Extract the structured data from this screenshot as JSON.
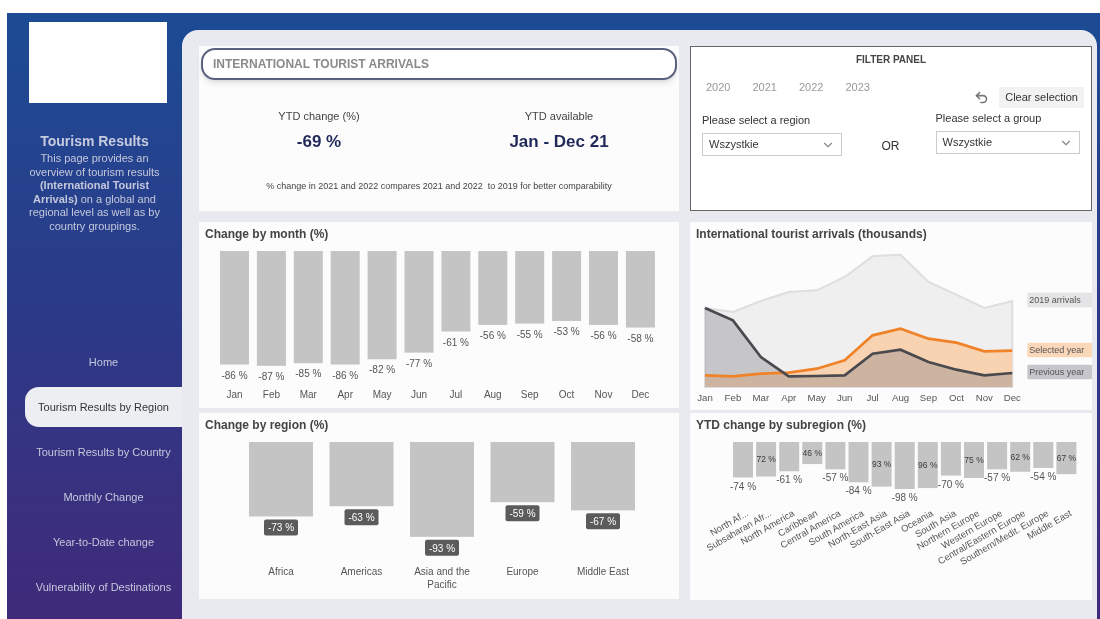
{
  "sidebar": {
    "title": "Tourism Results",
    "description": "This page provides an overview of tourism results **(International Tourist Arrivals)** on a global and regional level as well as by country groupings.",
    "nav": [
      {
        "label": "Home",
        "selected": false
      },
      {
        "label": "Tourism Results by Region",
        "selected": true
      },
      {
        "label": "Tourism Results by Country",
        "selected": false
      },
      {
        "label": "Monthly Change",
        "selected": false
      },
      {
        "label": "Year-to-Date change",
        "selected": false
      },
      {
        "label": "Vulnerability of Destinations",
        "selected": false
      }
    ]
  },
  "kpi_card": {
    "title": "INTERNATIONAL TOURIST ARRIVALS",
    "kpis": [
      {
        "label": "YTD change (%)",
        "value": "-69 %"
      },
      {
        "label": "YTD available",
        "value": "Jan - Dec 21"
      }
    ],
    "note": "% change in 2021 and 2022 compares 2021 and 2022  to 2019 for better comparability"
  },
  "filter_panel": {
    "title": "FILTER PANEL",
    "years": [
      "2020",
      "2021",
      "2022",
      "2023"
    ],
    "clear_button": "Clear selection",
    "region": {
      "label": "Please select a region",
      "value": "Wszystkie"
    },
    "separator": "OR",
    "group": {
      "label": "Please select a group",
      "value": "Wszystkie"
    }
  },
  "month_chart": {
    "title": "Change by month (%)",
    "chart_data": {
      "type": "bar",
      "categories": [
        "Jan",
        "Feb",
        "Mar",
        "Apr",
        "May",
        "Jun",
        "Jul",
        "Aug",
        "Sep",
        "Oct",
        "Nov",
        "Dec"
      ],
      "values": [
        -86,
        -87,
        -85,
        -86,
        -82,
        -77,
        -61,
        -56,
        -55,
        -53,
        -56,
        -58
      ],
      "value_labels": [
        "-86 %",
        "-87 %",
        "-85 %",
        "-86 %",
        "-82 %",
        "-77 %",
        "-61 %",
        "-56 %",
        "-55 %",
        "-53 %",
        "-56 %",
        "-58 %"
      ]
    }
  },
  "arrivals_chart": {
    "title": "International tourist arrivals (thousands)",
    "months": [
      "Jan",
      "Feb",
      "Mar",
      "Apr",
      "May",
      "Jun",
      "Jul",
      "Aug",
      "Sep",
      "Oct",
      "Nov",
      "Dec"
    ],
    "legend": [
      {
        "label": "2019 arrivals",
        "color": "#e4e4e6"
      },
      {
        "label": "Selected year",
        "color": "#f9d7b8"
      },
      {
        "label": "Previous year",
        "color": "#c6c6cc"
      }
    ]
  },
  "region_chart": {
    "title": "Change by region (%)",
    "chart_data": {
      "type": "bar",
      "categories": [
        "Africa",
        "Americas",
        "Asia and the Pacific",
        "Europe",
        "Middle East"
      ],
      "values": [
        -73,
        -63,
        -93,
        -59,
        -67
      ],
      "value_labels": [
        "-73 %",
        "-63 %",
        "-93 %",
        "-59 %",
        "-67 %"
      ]
    }
  },
  "subregion_chart": {
    "title": "YTD change by subregion (%)",
    "chart_data": {
      "type": "bar",
      "categories": [
        "North Af...",
        "Subsaharan Afr...",
        "North America",
        "Caribbean",
        "Central America",
        "South America",
        "North-East Asia",
        "South-East Asia",
        "Oceania",
        "South Asia",
        "Northern Europe",
        "Western Europe",
        "Central/Eastern Europe",
        "Southern/Medit. Europe",
        "Middle East"
      ],
      "values": [
        -74,
        -72,
        -61,
        -46,
        -57,
        -84,
        -93,
        -98,
        -96,
        -70,
        -75,
        -57,
        -62,
        -54,
        -67
      ],
      "value_labels": [
        "-74 %",
        null,
        "-61 %",
        null,
        "-57 %",
        "-84 %",
        null,
        "-98 %",
        null,
        "-70 %",
        null,
        "-57 %",
        null,
        "-54 %",
        null
      ]
    },
    "inside_labels": [
      "72 %",
      "46 %",
      "93 %",
      "96 %",
      "75 %",
      "62 %",
      "67 %"
    ]
  }
}
